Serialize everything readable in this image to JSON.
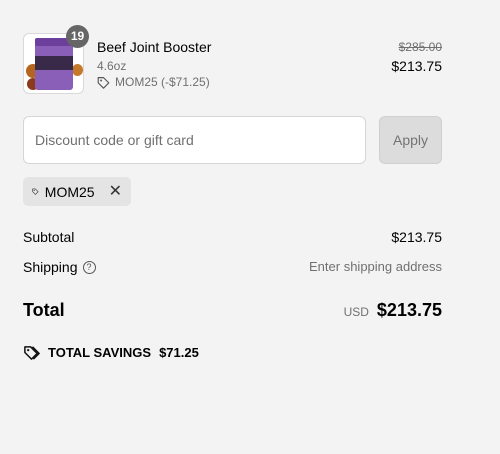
{
  "product": {
    "quantity": "19",
    "name": "Beef Joint Booster",
    "variant": "4.6oz",
    "discount_label": "MOM25 (-$71.25)",
    "original_price": "$285.00",
    "price": "$213.75"
  },
  "discount": {
    "placeholder": "Discount code or gift card",
    "value": "",
    "apply_label": "Apply"
  },
  "applied_code": {
    "code": "MOM25"
  },
  "summary": {
    "subtotal_label": "Subtotal",
    "subtotal_value": "$213.75",
    "shipping_label": "Shipping",
    "shipping_value": "Enter shipping address",
    "total_label": "Total",
    "currency": "USD",
    "total_value": "$213.75",
    "savings_label": "TOTAL SAVINGS",
    "savings_value": "$71.25"
  },
  "colors": {
    "background": "#f3f3f3",
    "muted_text": "#707070",
    "apply_button_bg": "#dcdcdc",
    "chip_bg": "#e4e4e4",
    "badge_bg": "#666666"
  }
}
